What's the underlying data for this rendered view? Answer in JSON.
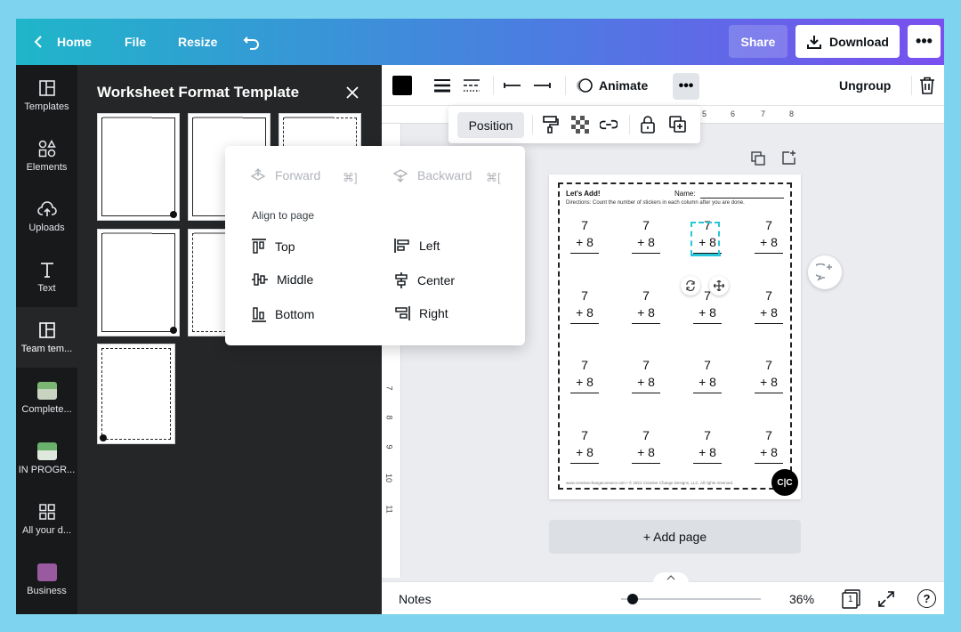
{
  "topbar": {
    "home_label": "Home",
    "file_label": "File",
    "resize_label": "Resize",
    "share_label": "Share",
    "download_label": "Download",
    "more_label": "•••"
  },
  "rail": {
    "items": [
      {
        "label": "Templates",
        "icon": "layout-icon"
      },
      {
        "label": "Elements",
        "icon": "shapes-icon"
      },
      {
        "label": "Uploads",
        "icon": "cloud-upload-icon"
      },
      {
        "label": "Text",
        "icon": "text-icon"
      },
      {
        "label": "Team tem...",
        "icon": "layout-icon"
      },
      {
        "label": "Complete...",
        "icon": "folder-thumbnail"
      },
      {
        "label": "IN PROGR...",
        "icon": "folder-thumbnail"
      },
      {
        "label": "All your d...",
        "icon": "grid-icon"
      },
      {
        "label": "Business",
        "icon": "folder-thumbnail"
      }
    ]
  },
  "panel": {
    "title": "Worksheet Format Template"
  },
  "toolbar": {
    "animate_label": "Animate",
    "more_label": "•••",
    "ungroup_label": "Ungroup",
    "ruler_numbers": [
      "5",
      "6",
      "7",
      "8"
    ],
    "ruler_left_numbers": [
      "7",
      "8",
      "9",
      "10",
      "11"
    ]
  },
  "position_bar": {
    "position_label": "Position"
  },
  "dropdown": {
    "forward_label": "Forward",
    "forward_shortcut": "⌘]",
    "backward_label": "Backward",
    "backward_shortcut": "⌘[",
    "align_heading": "Align to page",
    "top_label": "Top",
    "left_label": "Left",
    "middle_label": "Middle",
    "center_label": "Center",
    "bottom_label": "Bottom",
    "right_label": "Right"
  },
  "worksheet": {
    "title": "Let's Add!",
    "name_label": "Name:",
    "directions": "Directions: Count the number of stickers in each column after you are done.",
    "top_number": "7",
    "bottom_number": "+ 8",
    "footer": "www.creativechangeconnect.com  •  © 2021 Creative Change Designs, LLC. All rights reserved.",
    "logo": "C|C"
  },
  "add_page_label": "+ Add page",
  "bottombar": {
    "notes_label": "Notes",
    "zoom_label": "36%",
    "page_count": "1",
    "help_label": "?",
    "zoom_fraction": 0.05
  },
  "colors": {
    "gradient_start": "#1fb6c9",
    "gradient_end": "#7a4ff0",
    "selection": "#27c5d8",
    "rail_bg": "#18191b",
    "panel_bg": "#252627"
  }
}
